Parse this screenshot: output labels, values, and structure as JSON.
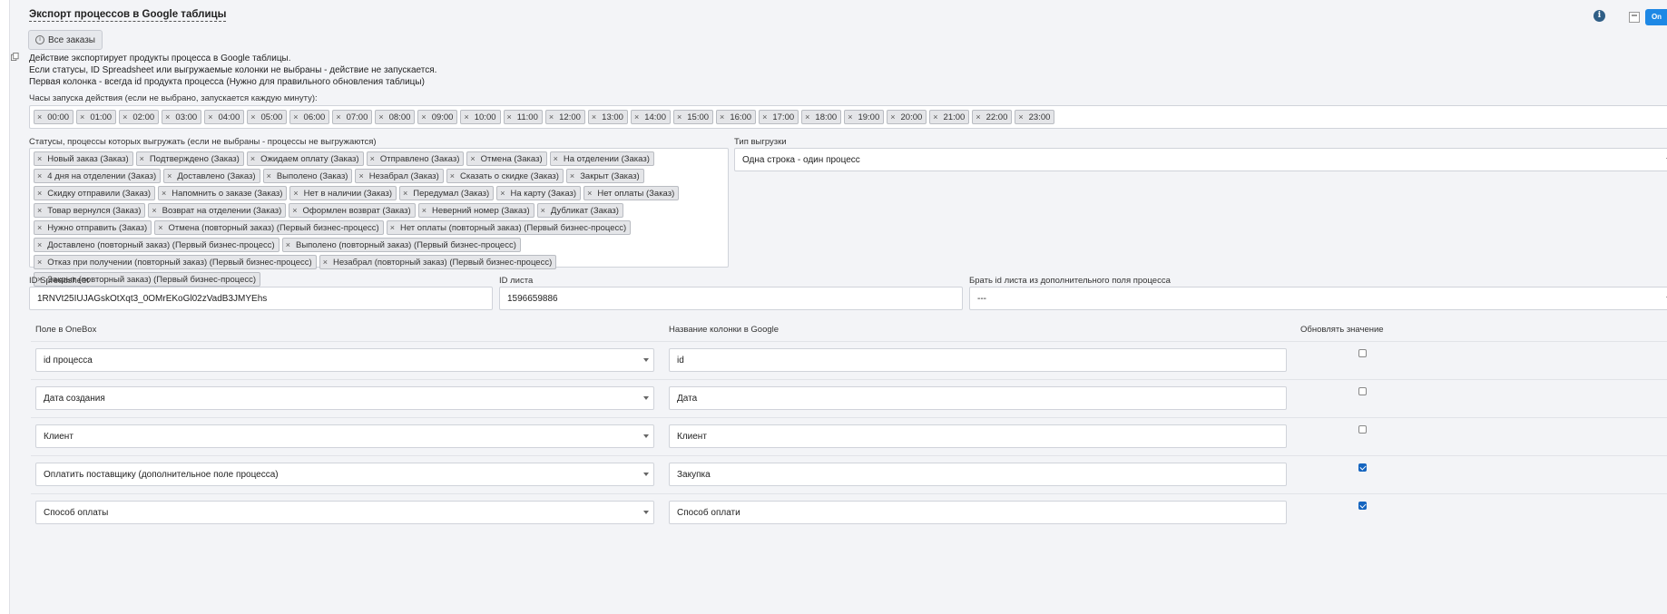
{
  "header": {
    "title": "Экспорт процессов в Google таблицы",
    "all_orders_button": "Все заказы",
    "toggle_label": "On"
  },
  "description": [
    "Действие экспортирует продукты процесса в Google таблицы.",
    "Если статусы, ID Spreadsheet или выгружаемые колонки не выбраны - действие не запускается.",
    "Первая колонка - всегда id продукта процесса (Нужно для правильного обновления таблицы)"
  ],
  "hours": {
    "label": "Часы запуска действия (если не выбрано, запускается каждую минуту):",
    "tags": [
      "00:00",
      "01:00",
      "02:00",
      "03:00",
      "04:00",
      "05:00",
      "06:00",
      "07:00",
      "08:00",
      "09:00",
      "10:00",
      "11:00",
      "12:00",
      "13:00",
      "14:00",
      "15:00",
      "16:00",
      "17:00",
      "18:00",
      "19:00",
      "20:00",
      "21:00",
      "22:00",
      "23:00"
    ]
  },
  "statuses": {
    "label": "Статусы, процессы которых выгружать (если не выбраны - процессы не выгружаются)",
    "tags": [
      "Новый заказ (Заказ)",
      "Подтверждено (Заказ)",
      "Ожидаем оплату (Заказ)",
      "Отправлено (Заказ)",
      "Отмена (Заказ)",
      "На отделении (Заказ)",
      "4 дня на отделении (Заказ)",
      "Доставлено (Заказ)",
      "Выполено (Заказ)",
      "Незабрал (Заказ)",
      "Сказать о скидке (Заказ)",
      "Закрыт (Заказ)",
      "Скидку отправили (Заказ)",
      "Напомнить о заказе (Заказ)",
      "Нет в наличии (Заказ)",
      "Передумал (Заказ)",
      "На карту (Заказ)",
      "Нет оплаты (Заказ)",
      "Товар вернулся (Заказ)",
      "Возврат на отделении (Заказ)",
      "Оформлен возврат (Заказ)",
      "Неверний номер (Заказ)",
      "Дубликат (Заказ)",
      "Нужно отправить (Заказ)",
      "Отмена (повторный заказ) (Первый бизнес-процесс)",
      "Нет оплаты (повторный заказ) (Первый бизнес-процесс)",
      "Доставлено (повторный заказ) (Первый бизнес-процесс)",
      "Выполено (повторный заказ) (Первый бизнес-процесс)",
      "Отказ при получении (повторный заказ) (Первый бизнес-процесс)",
      "Незабрал (повторный заказ) (Первый бизнес-процесс)",
      "Закрыт (повторный заказ) (Первый бизнес-процесс)"
    ]
  },
  "upload_type": {
    "label": "Тип выгрузки",
    "value": "Одна строка - один процесс"
  },
  "spreadsheet": {
    "label": "ID Spreadsheet",
    "value": "1RNVt25IUJAGskOtXqt3_0OMrEKoGl02zVadB3JMYEhs"
  },
  "sheet": {
    "label": "ID листа",
    "value": "1596659886"
  },
  "sheet_from_field": {
    "label": "Брать id листа из дополнительного поля процесса",
    "value": "---"
  },
  "columns": {
    "headers": [
      "Поле в OneBox",
      "Название колонки в Google",
      "Обновлять значение"
    ],
    "rows": [
      {
        "field": "id процесса",
        "google": "id",
        "update": false
      },
      {
        "field": "Дата создания",
        "google": "Дата",
        "update": false
      },
      {
        "field": "Клиент",
        "google": "Клиент",
        "update": false
      },
      {
        "field": "Оплатить поставщику (дополнительное поле процесса)",
        "google": "Закупка",
        "update": true
      },
      {
        "field": "Способ оплаты",
        "google": "Способ оплати",
        "update": true
      }
    ]
  },
  "colors": {
    "accent": "#1565c0",
    "toggle": "#1e88e5",
    "info": "#2f5e86"
  }
}
